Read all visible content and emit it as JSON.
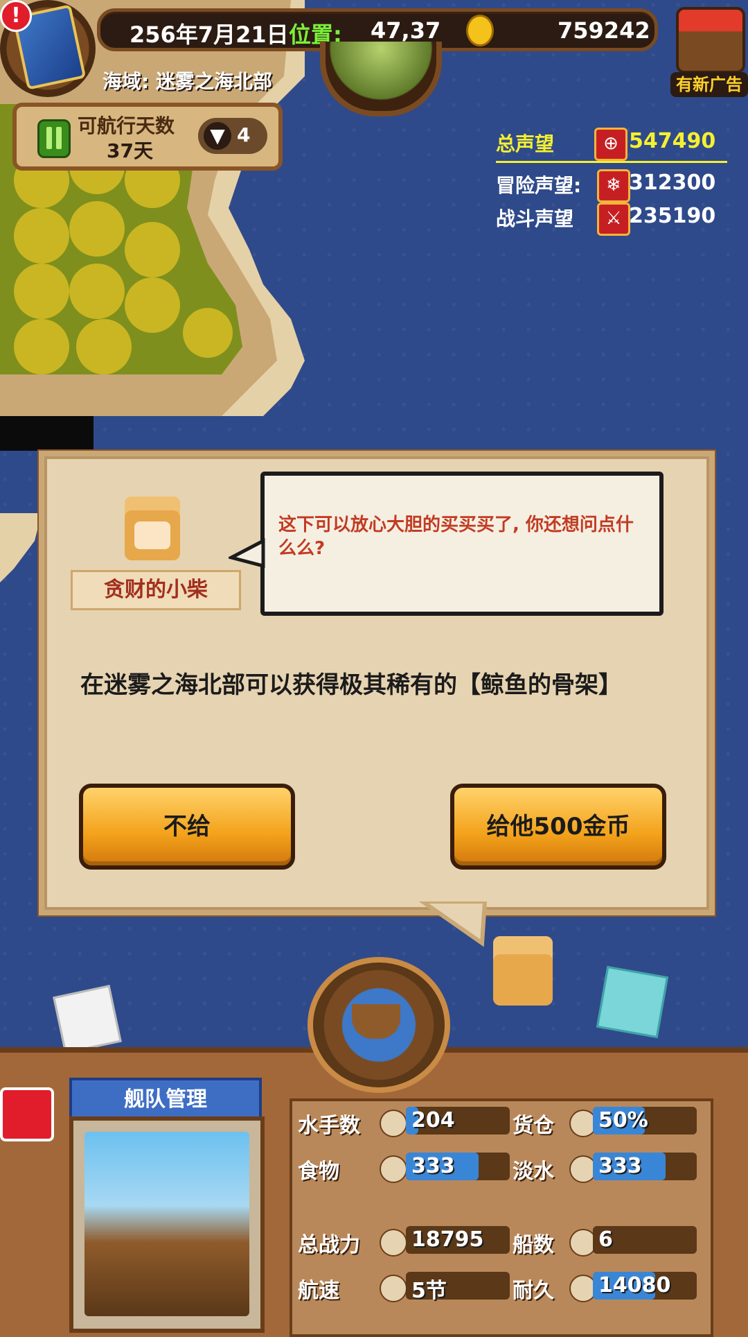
{
  "hud": {
    "date": "256年7月21日",
    "position_label": "位置:",
    "position_value": "47,37",
    "gold": "759242",
    "region": "海域: 迷雾之海北部",
    "ad_badge": "有新广告",
    "sail_days_label": "可航行天数",
    "sail_days_value": "37天",
    "speed_multiplier": "4",
    "alert_symbol": "!"
  },
  "reputation": {
    "total_label": "总声望",
    "total_value": "547490",
    "adventure_label": "冒险声望:",
    "adventure_value": "312300",
    "battle_label": "战斗声望",
    "battle_value": "235190"
  },
  "dialog": {
    "npc_name": "贪财的小柴",
    "speech": "这下可以放心大胆的买买买了, 你还想问点什么么?",
    "message": "在迷雾之海北部可以获得极其稀有的【鲸鱼的骨架】",
    "refuse_label": "不给",
    "give_label": "给他500金币"
  },
  "fleet": {
    "title": "舰队管理",
    "stats": [
      {
        "label": "水手数",
        "value": "204",
        "icon": "sailor-icon",
        "fill": 0.12
      },
      {
        "label": "货仓",
        "value": "50%",
        "icon": "cargo-icon",
        "fill": 0.5
      },
      {
        "label": "食物",
        "value": "333",
        "icon": "meat-icon",
        "fill": 0.7
      },
      {
        "label": "淡水",
        "value": "333",
        "icon": "water-icon",
        "fill": 0.7
      },
      {
        "label": "总战力",
        "value": "18795",
        "icon": "skull-icon",
        "fill": 0.0
      },
      {
        "label": "船数",
        "value": "6",
        "icon": "ship-count-icon",
        "fill": 0.0
      },
      {
        "label": "航速",
        "value": "5节",
        "icon": "speed-icon",
        "fill": 0.0
      },
      {
        "label": "耐久",
        "value": "14080",
        "icon": "durability-icon",
        "fill": 0.6
      }
    ]
  },
  "colors": {
    "sea": "#2f4a8a",
    "button": "#f3a21a",
    "dialog": "#e6d3b1",
    "rep_total": "#f6f02f",
    "bar_fill": "#3a86d6"
  }
}
